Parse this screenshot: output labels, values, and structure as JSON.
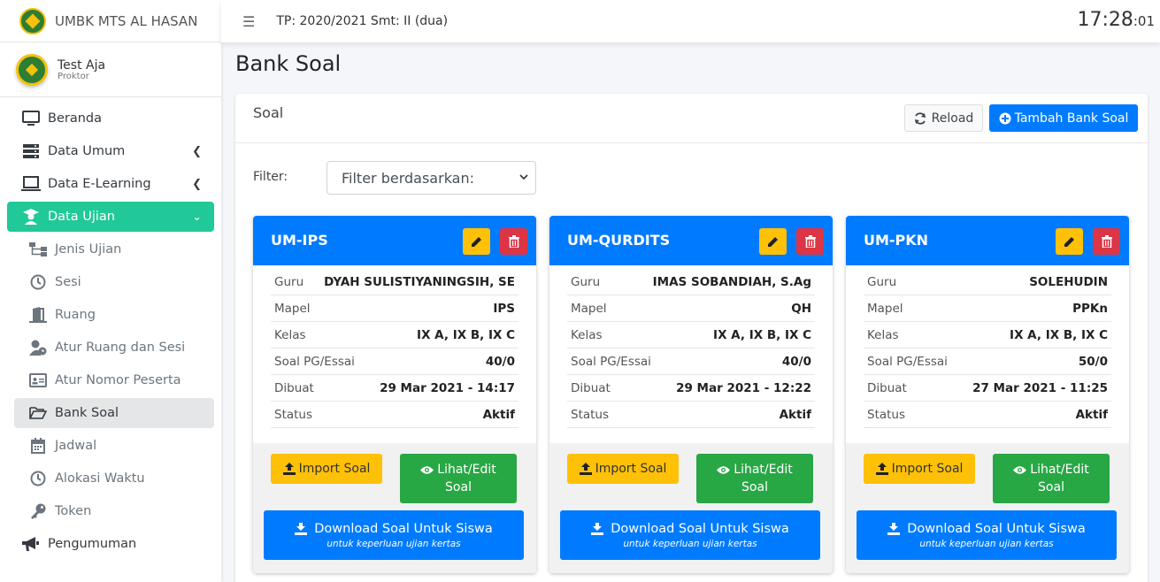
{
  "brand": {
    "name": "UMBK MTS AL HASAN"
  },
  "user": {
    "name": "Test Aja",
    "role": "Proktor"
  },
  "sidebar": {
    "items": [
      {
        "label": "Beranda"
      },
      {
        "label": "Data Umum"
      },
      {
        "label": "Data E-Learning"
      },
      {
        "label": "Data Ujian"
      }
    ],
    "subitems": [
      {
        "label": "Jenis Ujian"
      },
      {
        "label": "Sesi"
      },
      {
        "label": "Ruang"
      },
      {
        "label": "Atur Ruang dan Sesi"
      },
      {
        "label": "Atur Nomor Peserta"
      },
      {
        "label": "Bank Soal"
      },
      {
        "label": "Jadwal"
      },
      {
        "label": "Alokasi Waktu"
      },
      {
        "label": "Token"
      }
    ],
    "bottom": {
      "label": "Pengumuman"
    }
  },
  "topbar": {
    "tp": "TP: 2020/2021 Smt: II (dua)",
    "clock_hm": "17:28",
    "clock_s": ":01"
  },
  "page": {
    "title": "Bank Soal"
  },
  "card": {
    "title": "Soal",
    "reload_label": "Reload",
    "add_label": "Tambah Bank Soal",
    "filter_label": "Filter:",
    "filter_value": "Filter berdasarkan:"
  },
  "labels": {
    "guru": "Guru",
    "mapel": "Mapel",
    "kelas": "Kelas",
    "soal": "Soal PG/Essai",
    "dibuat": "Dibuat",
    "status": "Status",
    "import": "Import Soal",
    "lihat1": "Lihat/Edit",
    "lihat2": "Soal",
    "download": "Download Soal Untuk Siswa",
    "download_sub": "untuk keperluan ujian kertas"
  },
  "banks": [
    {
      "title": "UM-IPS",
      "guru": "DYAH SULISTIYANINGSIH, SE",
      "mapel": "IPS",
      "kelas": "IX A, IX B, IX C",
      "soal": "40/0",
      "dibuat": "29 Mar 2021 - 14:17",
      "status": "Aktif"
    },
    {
      "title": "UM-QURDITS",
      "guru": "IMAS SOBANDIAH, S.Ag",
      "mapel": "QH",
      "kelas": "IX A, IX B, IX C",
      "soal": "40/0",
      "dibuat": "29 Mar 2021 - 12:22",
      "status": "Aktif"
    },
    {
      "title": "UM-PKN",
      "guru": "SOLEHUDIN",
      "mapel": "PPKn",
      "kelas": "IX A, IX B, IX C",
      "soal": "50/0",
      "dibuat": "27 Mar 2021 - 11:25",
      "status": "Aktif"
    }
  ],
  "colors": {
    "primary": "#007bff",
    "accent": "#20c997",
    "warning": "#ffc107",
    "danger": "#dc3545",
    "success": "#28a745"
  }
}
